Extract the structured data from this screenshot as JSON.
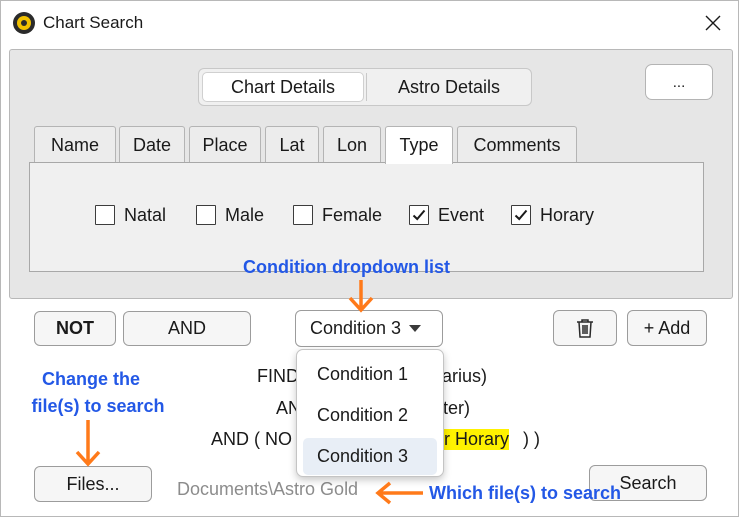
{
  "window": {
    "title": "Chart Search",
    "app_icon": "astro-gold-app-icon",
    "close_icon": "close-icon"
  },
  "segment": {
    "items": [
      {
        "label": "Chart Details",
        "active": true
      },
      {
        "label": "Astro Details",
        "active": false
      }
    ]
  },
  "more_button": {
    "label": "..."
  },
  "tabs": [
    {
      "label": "Name",
      "active": false
    },
    {
      "label": "Date",
      "active": false
    },
    {
      "label": "Place",
      "active": false
    },
    {
      "label": "Lat",
      "active": false
    },
    {
      "label": "Lon",
      "active": false
    },
    {
      "label": "Type",
      "active": true
    },
    {
      "label": "Comments",
      "active": false
    }
  ],
  "type_checkboxes": [
    {
      "label": "Natal",
      "checked": false
    },
    {
      "label": "Male",
      "checked": false
    },
    {
      "label": "Female",
      "checked": false
    },
    {
      "label": "Event",
      "checked": true
    },
    {
      "label": "Horary",
      "checked": true
    }
  ],
  "logic": {
    "not_label": "NOT",
    "and_label": "AND",
    "delete_icon": "trash-icon",
    "add_label": "+ Add"
  },
  "condition_dropdown": {
    "selected": "Condition 3",
    "caret_icon": "chevron-down-icon",
    "options": [
      "Condition 1",
      "Condition 2",
      "Condition 3"
    ]
  },
  "query": {
    "line1_prefix": "FIND",
    "line1_suffix": "arius)",
    "line2_prefix": "AN",
    "line2_suffix": "ter)",
    "line3_prefix": "AND ( NO",
    "line3_highlight": "r Horary",
    "line3_suffix": ") )"
  },
  "footer": {
    "files_label": "Files...",
    "path": "Documents\\Astro Gold",
    "search_label": "Search"
  },
  "annotations": {
    "dropdown_note": "Condition dropdown list",
    "files_note_line1": "Change the",
    "files_note_line2": "file(s) to search",
    "path_note": "Which file(s) to search"
  },
  "colors": {
    "annotation_text": "#2358e6",
    "annotation_arrow": "#ff7a1a",
    "highlight": "#fff200",
    "panel_bg": "#e6e6e6"
  }
}
